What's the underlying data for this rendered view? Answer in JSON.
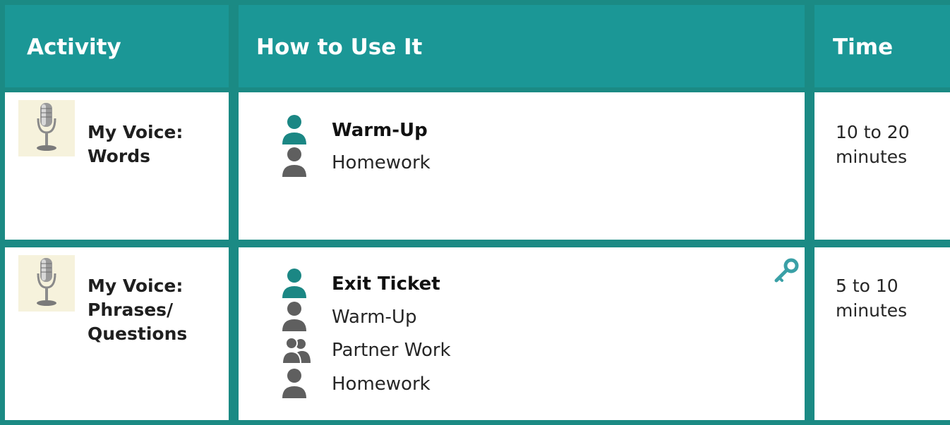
{
  "header": {
    "activity": "Activity",
    "how_to_use": "How to Use It",
    "time": "Time"
  },
  "rows": [
    {
      "activity_label_line1": "My Voice:",
      "activity_label_line2": "Words",
      "activity_icon": "microphone-icon",
      "uses": [
        {
          "label": "Warm-Up",
          "icon": "person-icon",
          "primary": true
        },
        {
          "label": "Homework",
          "icon": "person-icon",
          "primary": false
        }
      ],
      "time_line1": "10 to 20",
      "time_line2": "minutes"
    },
    {
      "activity_label_line1": "My Voice:",
      "activity_label_line2": "Phrases/",
      "activity_label_line3": "Questions",
      "activity_icon": "microphone-icon",
      "extra_icon": "key-icon",
      "uses": [
        {
          "label": "Exit Ticket",
          "icon": "person-icon",
          "primary": true
        },
        {
          "label": "Warm-Up",
          "icon": "person-icon",
          "primary": false
        },
        {
          "label": "Partner Work",
          "icon": "people-icon",
          "primary": false
        },
        {
          "label": "Homework",
          "icon": "person-icon",
          "primary": false
        }
      ],
      "time_line1": "5 to 10",
      "time_line2": "minutes"
    }
  ],
  "colors": {
    "header_bg": "#1b9796",
    "border": "#1b8a84",
    "primary_icon": "#1b8784",
    "secondary_icon": "#5f5f5f",
    "header_text": "#ffffff"
  }
}
